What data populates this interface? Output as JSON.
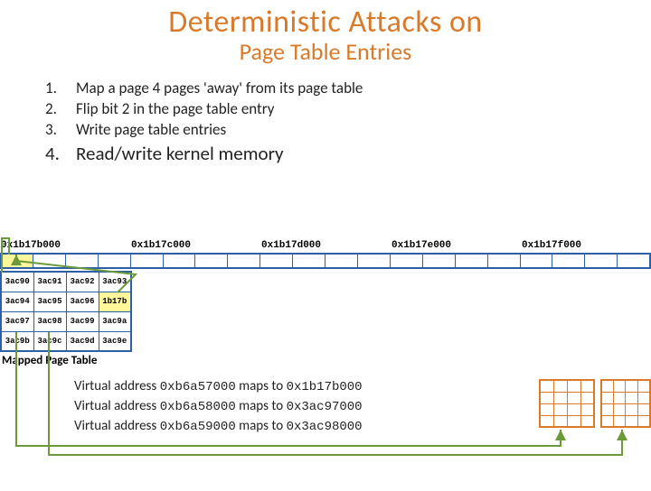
{
  "title": "Deterministic Attacks on",
  "subtitle": "Page Table Entries",
  "steps": [
    {
      "n": "1.",
      "t": "Map a page 4 pages 'away' from its page table"
    },
    {
      "n": "2.",
      "t": "Flip bit 2 in the page table entry"
    },
    {
      "n": "3.",
      "t": "Write page table entries"
    }
  ],
  "step4": {
    "n": "4.",
    "t": "Read/write kernel memory"
  },
  "addresses": [
    "0x1b17b000",
    "0x1b17c000",
    "0x1b17d000",
    "0x1b17e000",
    "0x1b17f000"
  ],
  "page_table_label": "Mapped Page Table",
  "pt_rows": [
    [
      "3ac90",
      "3ac91",
      "3ac92",
      "3ac93"
    ],
    [
      "3ac94",
      "3ac95",
      "3ac96",
      "1b17b"
    ],
    [
      "3ac97",
      "3ac98",
      "3ac99",
      "3ac9a"
    ],
    [
      "3ac9b",
      "3ac9c",
      "3ac9d",
      "3ac9e"
    ]
  ],
  "pt_highlight": {
    "row": 1,
    "col": 3
  },
  "maps": [
    {
      "va": "0xb6a57000",
      "pa": "0x1b17b000"
    },
    {
      "va": "0xb6a58000",
      "pa": "0x3ac97000"
    },
    {
      "va": "0xb6a59000",
      "pa": "0x3ac98000"
    }
  ],
  "map_verb": "Virtual address",
  "map_mid": "maps to"
}
